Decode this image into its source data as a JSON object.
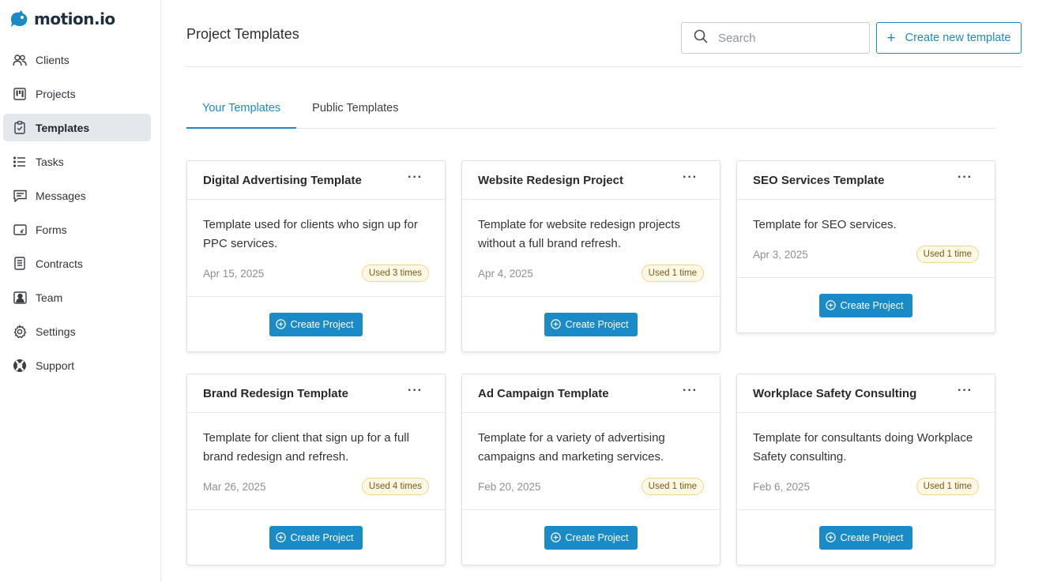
{
  "brand": {
    "name": "motion.io",
    "color": "#1a8bc7"
  },
  "sidebar": {
    "items": [
      {
        "label": "Clients",
        "icon": "users-icon",
        "active": false
      },
      {
        "label": "Projects",
        "icon": "kanban-icon",
        "active": false
      },
      {
        "label": "Templates",
        "icon": "clipboard-check-icon",
        "active": true
      },
      {
        "label": "Tasks",
        "icon": "list-icon",
        "active": false
      },
      {
        "label": "Messages",
        "icon": "message-icon",
        "active": false
      },
      {
        "label": "Forms",
        "icon": "form-icon",
        "active": false
      },
      {
        "label": "Contracts",
        "icon": "document-icon",
        "active": false
      },
      {
        "label": "Team",
        "icon": "person-card-icon",
        "active": false
      },
      {
        "label": "Settings",
        "icon": "gear-icon",
        "active": false
      },
      {
        "label": "Support",
        "icon": "lifebuoy-icon",
        "active": false
      }
    ]
  },
  "header": {
    "title": "Project Templates",
    "search_placeholder": "Search",
    "create_label": "Create new template"
  },
  "tabs": [
    {
      "label": "Your Templates",
      "active": true
    },
    {
      "label": "Public Templates",
      "active": false
    }
  ],
  "cards": [
    {
      "title": "Digital Advertising Template",
      "desc": "Template used for clients who sign up for PPC services.",
      "date": "Apr 15, 2025",
      "used": "Used 3 times",
      "button": "Create Project"
    },
    {
      "title": "Website Redesign Project",
      "desc": "Template for website redesign projects without a full brand refresh.",
      "date": "Apr 4, 2025",
      "used": "Used 1 time",
      "button": "Create Project"
    },
    {
      "title": "SEO Services Template",
      "desc": "Template for SEO services.",
      "date": "Apr 3, 2025",
      "used": "Used 1 time",
      "button": "Create Project"
    },
    {
      "title": "Brand Redesign Template",
      "desc": "Template for client that sign up for a full brand redesign and refresh.",
      "date": "Mar 26, 2025",
      "used": "Used 4 times",
      "button": "Create Project"
    },
    {
      "title": "Ad Campaign Template",
      "desc": "Template for a variety of advertising campaigns and marketing services.",
      "date": "Feb 20, 2025",
      "used": "Used 1 time",
      "button": "Create Project"
    },
    {
      "title": "Workplace Safety Consulting",
      "desc": "Template for consultants doing Workplace Safety consulting.",
      "date": "Feb 6, 2025",
      "used": "Used 1 time",
      "button": "Create Project"
    }
  ],
  "card_menu_glyph": "···",
  "create_glyph": "+"
}
